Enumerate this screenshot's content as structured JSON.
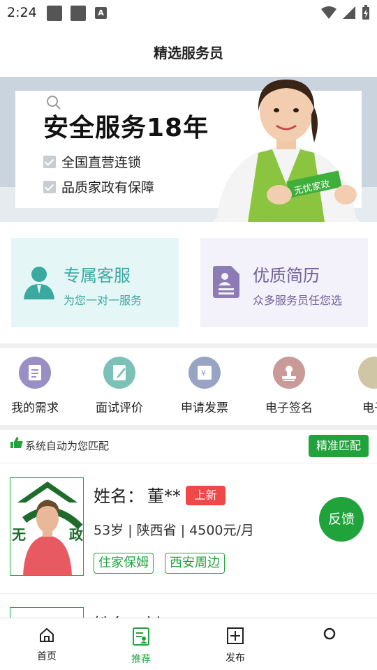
{
  "status_bar": {
    "time": "2:24",
    "notification_icon": "A"
  },
  "header": {
    "title": "精选服务员"
  },
  "banner": {
    "headline": "安全服务18年",
    "checks": [
      "全国直营连锁",
      "品质家政有保障"
    ],
    "apron_text": "无忧家政"
  },
  "services": [
    {
      "title": "专属客服",
      "subtitle": "为您一对一服务",
      "color": "#3aa99f",
      "icon": "customer-service-icon"
    },
    {
      "title": "优质简历",
      "subtitle": "众多服务员任您选",
      "color": "#8c7bb5",
      "icon": "resume-icon"
    }
  ],
  "quick_menu": [
    {
      "label": "我的需求",
      "color": "#9a8fc4",
      "icon": "requirements-icon"
    },
    {
      "label": "面试评价",
      "color": "#7cc1b8",
      "icon": "review-icon"
    },
    {
      "label": "申请发票",
      "color": "#97a4c4",
      "icon": "invoice-icon"
    },
    {
      "label": "电子签名",
      "color": "#c99a98",
      "icon": "signature-icon"
    },
    {
      "label": "电子",
      "color": "#cfc6a6",
      "icon": "contract-icon"
    }
  ],
  "match": {
    "text": "系统自动为您匹配",
    "button": "精准匹配"
  },
  "worker": {
    "name_label": "姓名：",
    "name": "董**",
    "badge": "上新",
    "info": "53岁 | 陕西省 | 4500元/月",
    "tags": [
      "住家保姆",
      "西安周边"
    ],
    "feedback": "反馈"
  },
  "next_worker": {
    "name_label": "姓名：刘**"
  },
  "bottom_nav": [
    {
      "label": "首页",
      "icon": "home-icon",
      "active": false
    },
    {
      "label": "推荐",
      "icon": "recommend-icon",
      "active": true
    },
    {
      "label": "发布",
      "icon": "publish-icon",
      "active": false
    }
  ],
  "colors": {
    "brand_green": "#21a33b",
    "badge_red": "#f04848"
  }
}
